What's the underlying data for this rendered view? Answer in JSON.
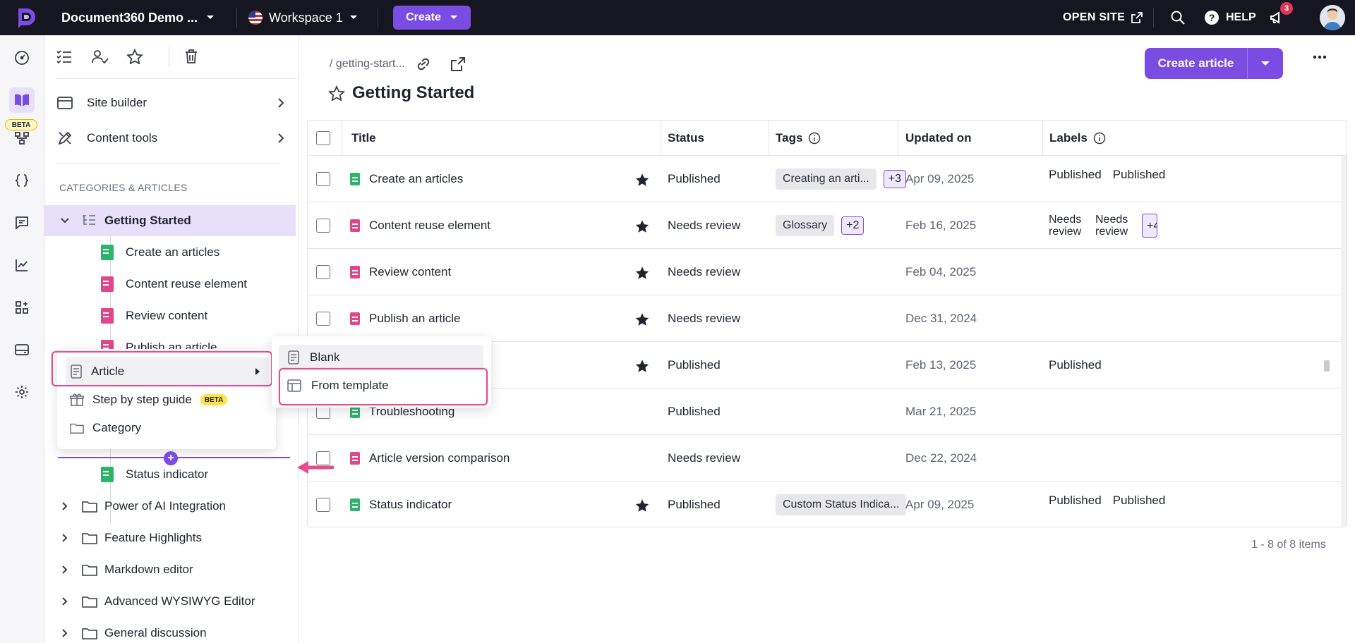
{
  "topbar": {
    "project_name": "Document360 Demo ...",
    "workspace": "Workspace 1",
    "create_label": "Create",
    "open_site": "OPEN SITE",
    "help": "HELP",
    "notifications_count": "3"
  },
  "rail": {
    "beta_tag": "BETA"
  },
  "sidebar": {
    "site_builder": "Site builder",
    "content_tools": "Content tools",
    "categories_heading": "CATEGORIES & ARTICLES",
    "tree": [
      {
        "label": "Getting Started",
        "kind": "category-open"
      },
      {
        "label": "Create an articles",
        "kind": "article-green"
      },
      {
        "label": "Content reuse element",
        "kind": "article-pink"
      },
      {
        "label": "Review content",
        "kind": "article-pink"
      },
      {
        "label": "Publish an article",
        "kind": "article-pink"
      },
      {
        "label": "Status indicator",
        "kind": "article-green"
      },
      {
        "label": "Power of AI Integration",
        "kind": "folder"
      },
      {
        "label": "Feature Highlights",
        "kind": "folder"
      },
      {
        "label": "Markdown editor",
        "kind": "folder"
      },
      {
        "label": "Advanced WYSIWYG Editor",
        "kind": "folder"
      },
      {
        "label": "General discussion",
        "kind": "folder"
      }
    ]
  },
  "add_menu": {
    "article": "Article",
    "step_guide": "Step by step guide",
    "step_guide_badge": "BETA",
    "category": "Category"
  },
  "article_submenu": {
    "blank": "Blank",
    "from_template": "From template"
  },
  "main": {
    "breadcrumb": "/ getting-start...",
    "title": "Getting Started",
    "create_article": "Create article",
    "columns": {
      "title": "Title",
      "status": "Status",
      "tags": "Tags",
      "updated_on": "Updated on",
      "labels": "Labels"
    },
    "rows": [
      {
        "title": "Create an articles",
        "doc": "green",
        "starred": true,
        "status": "Published",
        "tag": "Creating an arti...",
        "tag_more": "+3",
        "date": "Apr 09, 2025",
        "labels": [
          "Published",
          "Published"
        ]
      },
      {
        "title": "Content reuse element",
        "doc": "pink",
        "starred": true,
        "status": "Needs review",
        "tag": "Glossary",
        "tag_more": "+2",
        "date": "Feb 16, 2025",
        "labels": [
          "Needs review",
          "Needs review"
        ],
        "labels_more": "+4"
      },
      {
        "title": "Review content",
        "doc": "pink",
        "starred": true,
        "status": "Needs review",
        "tag": "",
        "tag_more": "",
        "date": "Feb 04, 2025",
        "labels": []
      },
      {
        "title": "Publish an article",
        "doc": "pink",
        "starred": true,
        "status": "Needs review",
        "tag": "",
        "tag_more": "",
        "date": "Dec 31, 2024",
        "labels": []
      },
      {
        "title": "",
        "doc": "green",
        "starred": true,
        "status": "Published",
        "tag": "",
        "tag_more": "",
        "date": "Feb 13, 2025",
        "labels": [
          "Published"
        ]
      },
      {
        "title": "Troubleshooting",
        "doc": "green",
        "starred": false,
        "status": "Published",
        "tag": "",
        "tag_more": "",
        "date": "Mar 21, 2025",
        "labels": []
      },
      {
        "title": "Article version comparison",
        "doc": "pink",
        "starred": false,
        "status": "Needs review",
        "tag": "",
        "tag_more": "",
        "date": "Dec 22, 2024",
        "labels": []
      },
      {
        "title": "Status indicator",
        "doc": "green",
        "starred": true,
        "status": "Published",
        "tag": "Custom Status Indica...",
        "tag_more": "",
        "date": "Apr 09, 2025",
        "labels": [
          "Published",
          "Published"
        ]
      }
    ],
    "pager": "1 - 8 of 8 items"
  },
  "colors": {
    "accent": "#7b4ce2",
    "topbar": "#161620",
    "highlight": "#e54d8c",
    "published_doc": "#2bb56b",
    "review_doc": "#e0468a"
  }
}
